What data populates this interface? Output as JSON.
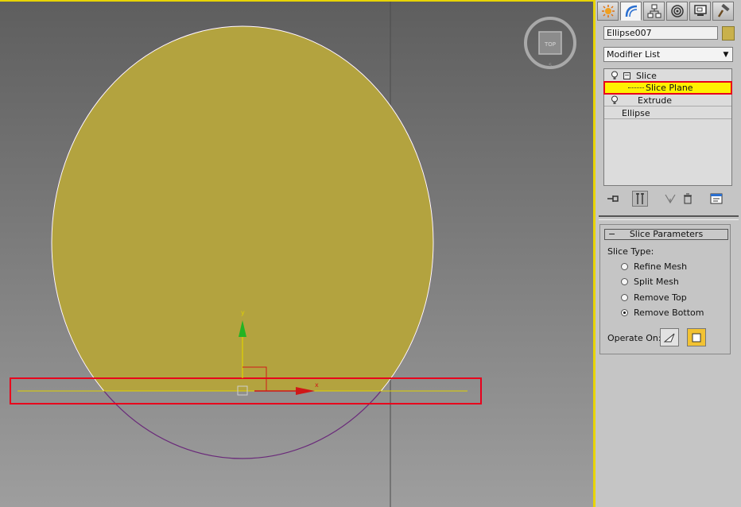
{
  "viewport": {
    "name": "Top",
    "viewcube_label": "TOP",
    "axis_x": "x",
    "axis_y": "y",
    "colors": {
      "shape_fill": "#b3a33f",
      "outline": "#6a2a7a",
      "slice_line": "#e0d000",
      "highlight_box": "#e8001c"
    }
  },
  "command_panel": {
    "tabs": [
      {
        "name": "create-tab",
        "icon": "sun-icon"
      },
      {
        "name": "modify-tab",
        "icon": "bend-icon",
        "active": true
      },
      {
        "name": "hierarchy-tab",
        "icon": "hierarchy-icon"
      },
      {
        "name": "motion-tab",
        "icon": "motion-icon"
      },
      {
        "name": "display-tab",
        "icon": "display-icon"
      },
      {
        "name": "utilities-tab",
        "icon": "hammer-icon"
      }
    ],
    "object_name": "Ellipse007",
    "object_color": "#c9b14c",
    "modifier_list": "Modifier List",
    "stack": [
      {
        "label": "Slice",
        "bulb": true,
        "expanded": true
      },
      {
        "label": "Slice Plane",
        "selected": true,
        "sub": true
      },
      {
        "label": "Extrude",
        "bulb": true
      },
      {
        "label": "Ellipse"
      }
    ],
    "slice_parameters": {
      "title": "Slice Parameters",
      "slice_type_label": "Slice Type:",
      "options": [
        {
          "label": "Refine Mesh",
          "checked": false
        },
        {
          "label": "Split Mesh",
          "checked": false
        },
        {
          "label": "Remove Top",
          "checked": false
        },
        {
          "label": "Remove Bottom",
          "checked": true
        }
      ],
      "operate_on_label": "Operate On:"
    }
  }
}
